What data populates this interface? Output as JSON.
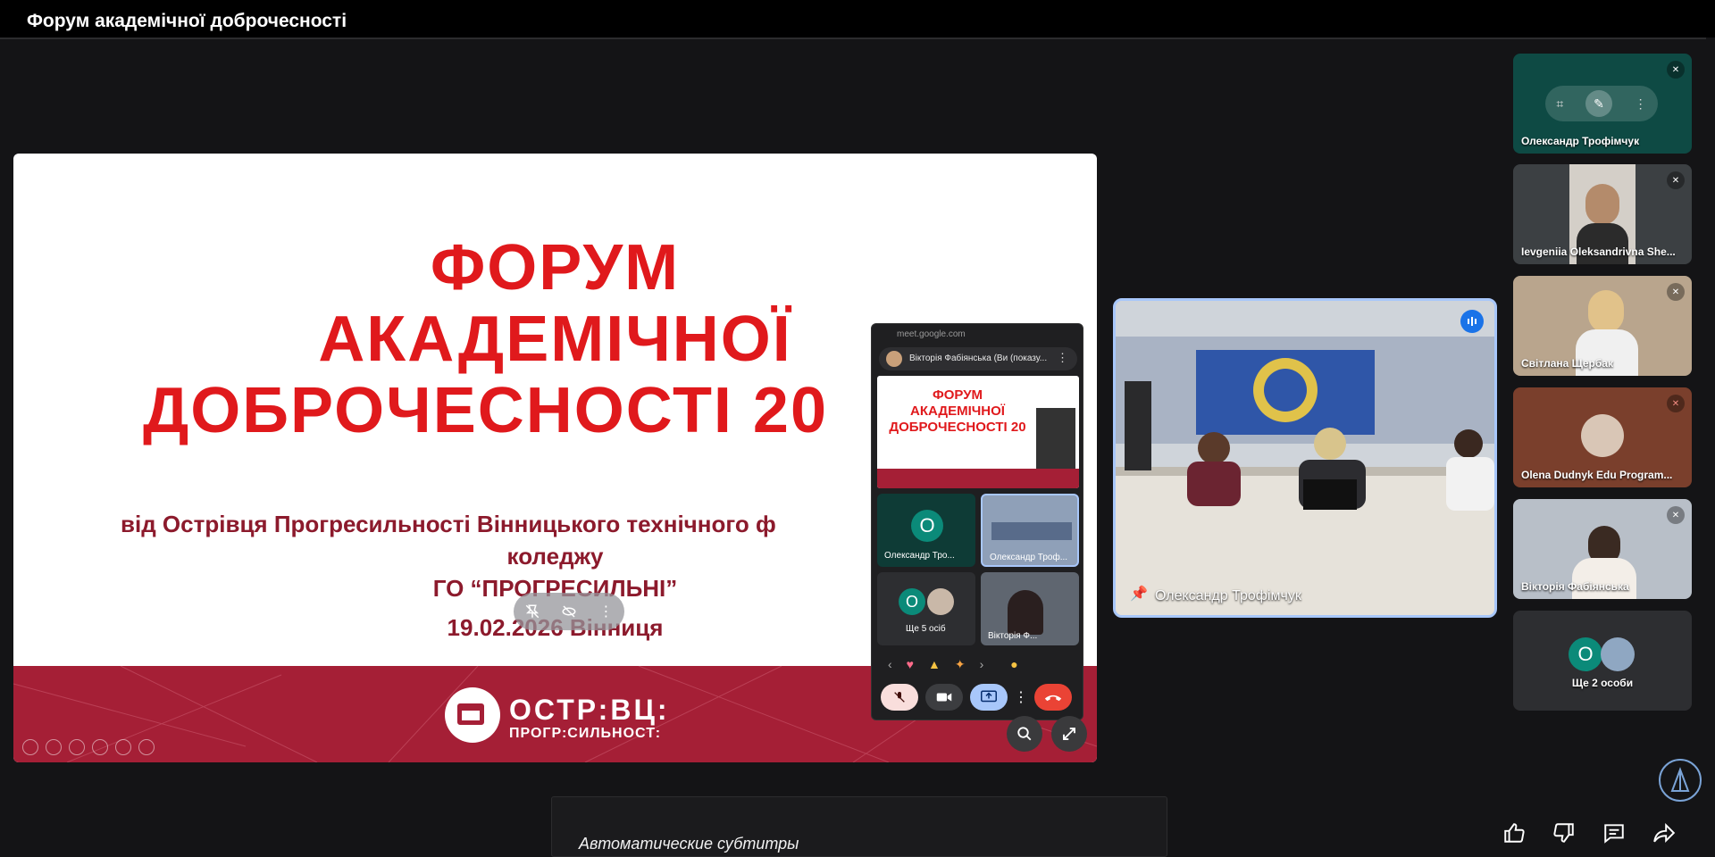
{
  "window": {
    "title": "Форум академічної доброчесності"
  },
  "slide": {
    "title_line1": "ФОРУМ",
    "title_line2": "АКАДЕМІЧНОЇ",
    "title_line3": "ДОБРОЧЕСНОСТІ 20",
    "subtitle_line1": "від Острівця Прогресильності Вінницького технічного ф",
    "subtitle_line2": "коледжу",
    "subtitle_line3": "ГО “ПРОГРЕСИЛЬНІ”",
    "date_place": "19.02.2026  Вінниця",
    "logo_text1": "ОСТР:ВЦ:",
    "logo_text2": "ПРОГР:СИЛЬНОСТ:"
  },
  "pip": {
    "url": "meet.google.com",
    "presenter": "Вікторія Фабіянська (Ви (показу...",
    "mini_title1": "ФОРУМ",
    "mini_title2": "АКАДЕМІЧНОЇ",
    "mini_title3": "ДОБРОЧЕСНОСТІ 20",
    "tile1_name": "Олександр Тро...",
    "tile1_initial": "О",
    "tile2_name": "Олександр Троф...",
    "tile3_label": "Ще 5 осіб",
    "tile3_initial": "О",
    "tile4_name": "Вікторія Ф..."
  },
  "main_camera": {
    "name": "Олександр Трофімчук"
  },
  "participants": [
    {
      "name": "Олександр Трофімчук"
    },
    {
      "name": "Ievgeniia Oleksandrivna She..."
    },
    {
      "name": "Світлана Щербак"
    },
    {
      "name": "Olena Dudnyk Edu Program..."
    },
    {
      "name": "Вікторія Фабіянська"
    },
    {
      "name": "Ще 2 особи",
      "initial": "О"
    }
  ],
  "captions": {
    "text": "Автоматические субтитры"
  },
  "icons": [
    "like-icon",
    "dislike-icon",
    "comment-icon",
    "share-icon",
    "pin-icon",
    "mic-off-icon",
    "camera-icon",
    "present-icon",
    "end-call-icon",
    "more-icon",
    "zoom-icon",
    "fullscreen-icon"
  ],
  "colors": {
    "accent_blue": "#a8c7fa",
    "slide_red": "#e0191c",
    "brand_maroon": "#a51f36",
    "avatar_teal": "#0b8a79",
    "end_call": "#ea4335"
  }
}
